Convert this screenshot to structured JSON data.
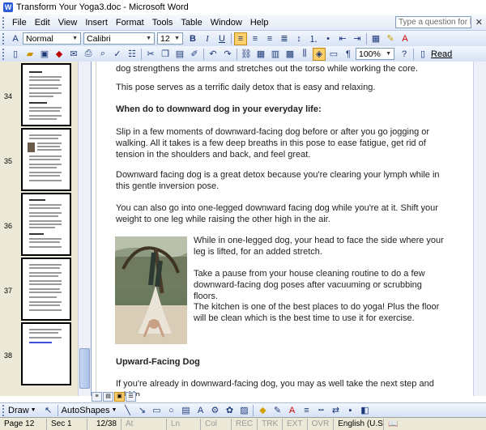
{
  "window": {
    "title": "Transform Your Yoga3.doc - Microsoft Word"
  },
  "menu": {
    "items": [
      "File",
      "Edit",
      "View",
      "Insert",
      "Format",
      "Tools",
      "Table",
      "Window",
      "Help"
    ],
    "ask_placeholder": "Type a question for help"
  },
  "formatting": {
    "style": "Normal",
    "font": "Calibri",
    "size": "12",
    "zoom": "100%",
    "read_label": "Read"
  },
  "thumbnails": [
    {
      "page": "34"
    },
    {
      "page": "35"
    },
    {
      "page": "36"
    },
    {
      "page": "37"
    },
    {
      "page": "38"
    }
  ],
  "document": {
    "p1": "dog strengthens the arms and stretches out the torso while working the core.",
    "p2": "This pose serves as a terrific daily detox that is easy and relaxing.",
    "h1": "When do to downward dog in your everyday life:",
    "p3": "Slip in a few moments of downward-facing dog before or after you go jogging or walking. All it takes is a few deep breaths in this pose to ease fatigue, get rid of tension in the shoulders and back, and feel great.",
    "p4": "Downward facing dog is a great detox because you're clearing your lymph while in this gentle inversion pose.",
    "p5": "You can also go into one-legged downward facing dog while you're at it. Shift your weight to one leg while raising the other high in the air.",
    "p6": "While in one-legged dog, your head to face the side where your leg is lifted, for an added stretch.",
    "p7": "Take a pause from your house cleaning routine to do a few downward-facing dog poses after vacuuming or scrubbing floors.",
    "p8": "The kitchen is one of the best places to do yoga! Plus the floor will be clean which is the best time to use it for exercise.",
    "h2": "Upward-Facing Dog",
    "p9": "If you're already in downward-facing dog, you may as well take the next step and add in"
  },
  "drawbar": {
    "draw_label": "Draw",
    "autoshapes_label": "AutoShapes"
  },
  "status": {
    "page": "Page 12",
    "sec": "Sec 1",
    "pages": "12/38",
    "at": "At",
    "ln": "Ln",
    "col": "Col",
    "rec": "REC",
    "trk": "TRK",
    "ext": "EXT",
    "ovr": "OVR",
    "lang": "English (U.S."
  }
}
